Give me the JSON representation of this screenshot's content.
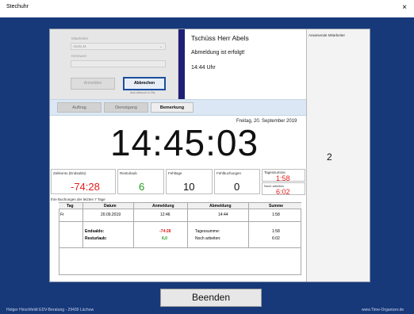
{
  "window": {
    "title": "Stechuhr",
    "close": "×"
  },
  "login": {
    "user_label": "Mitarbeiter",
    "user_value": "Abels,M.",
    "password_label": "Kennwort",
    "login_button": "Anmelden",
    "cancel_button": "Abbrechen",
    "auto_cancel": "Auto Abbruch in 29s"
  },
  "message": {
    "greeting": "Tschüss Herr Abels",
    "status": "Abmeldung ist erfolgt!",
    "time": "14:44 Uhr"
  },
  "tabs": [
    "Auftrag",
    "Dienstgang",
    "Bemerkung"
  ],
  "clock": {
    "date": "Freitag, 20. September 2019",
    "time": "14:45:03"
  },
  "right_panel": {
    "title": "Anwesende Mitarbeiter",
    "count": "2"
  },
  "stats": {
    "zeitkonto": {
      "label": "Zeitkonto (Endsaldo)",
      "value": "-74:28"
    },
    "resturlaub": {
      "label": "Resturlaub",
      "value": "6"
    },
    "fehltage": {
      "label": "Fehltage",
      "value": "10"
    },
    "fehlbuchungen": {
      "label": "Fehlbuchungen",
      "value": "0"
    },
    "tagessumme": {
      "label": "Tagessumme",
      "value": "1:58"
    },
    "noch_arbeiten": {
      "label": "Noch arbeiten",
      "value": "6:02"
    }
  },
  "bookings": {
    "caption": "Ihre Buchungen der letzten 7 Tage",
    "headers": [
      "Tag",
      "Datum",
      "Anmeldung",
      "Abmeldung",
      "Summe"
    ],
    "row": {
      "tag": "Fr",
      "datum": "20.09.2019",
      "anmeldung": "12:46",
      "abmeldung": "14:44",
      "summe": "1:58"
    },
    "endsaldo_label": "Endsaldo:",
    "endsaldo_value": "-74:28",
    "tagessumme_label": "Tagessumme:",
    "tagessumme_value": "1:58",
    "resturlaub_label": "Resturlaub:",
    "resturlaub_value": "6,0",
    "noch_label": "Noch arbeiten:",
    "noch_value": "6:02"
  },
  "footer": {
    "left": "Holger Hirschfeldt EDV-Beratung - 29439 Lüchow",
    "right": "www.Time-Organizer.de",
    "button": "Beenden"
  },
  "colors": {
    "frame": "#17397a",
    "negative": "#e31b1b",
    "positive": "#1f9a1f",
    "navy": "#201f75"
  }
}
